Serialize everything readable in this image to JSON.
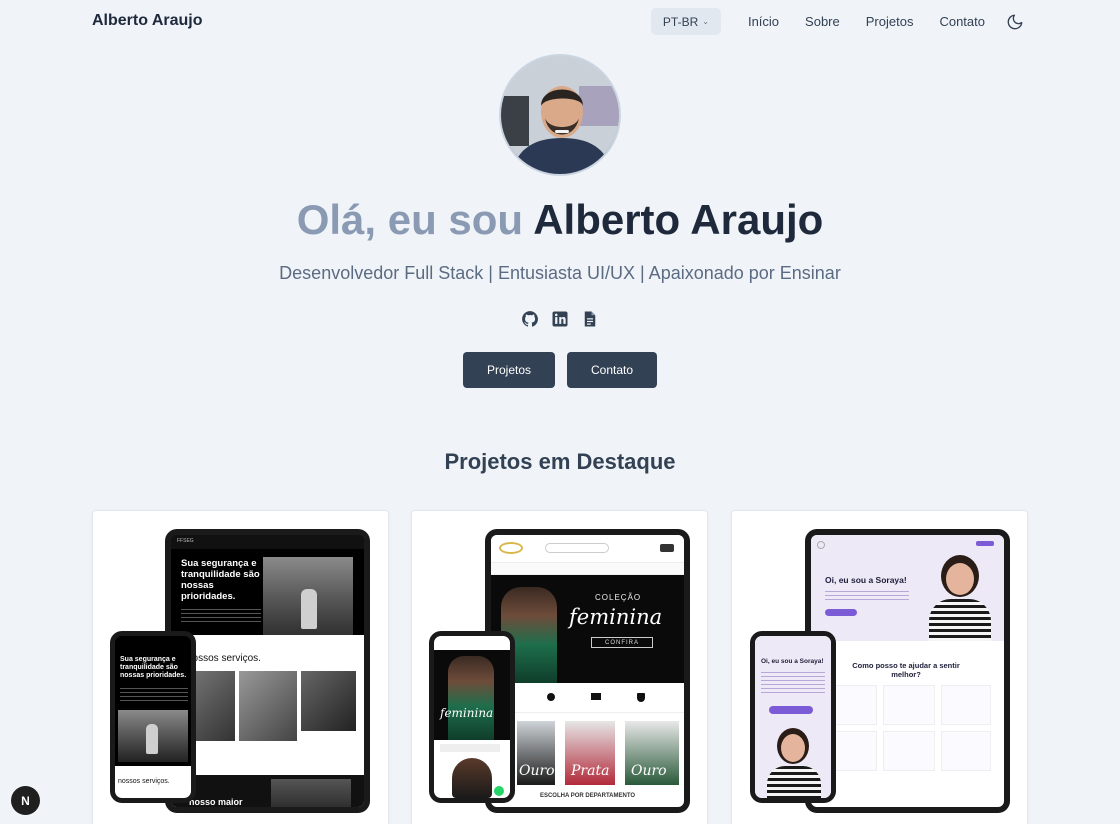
{
  "header": {
    "brand": "Alberto Araujo",
    "lang": "PT-BR",
    "nav": [
      "Início",
      "Sobre",
      "Projetos",
      "Contato"
    ]
  },
  "hero": {
    "greeting": "Olá, eu sou ",
    "name": "Alberto Araujo",
    "subtitle": "Desenvolvedor Full Stack | Entusiasta UI/UX | Apaixonado por Ensinar",
    "socials": [
      "github-icon",
      "linkedin-icon",
      "document-icon"
    ],
    "buttons": {
      "projects": "Projetos",
      "contact": "Contato"
    }
  },
  "featured": {
    "title": "Projetos em Destaque",
    "cards": [
      {
        "tablet_headline": "Sua segurança e tranquilidade são nossas prioridades.",
        "services": "nossos serviços.",
        "phone_headline": "Sua segurança e tranquilidade são nossas prioridades.",
        "phone_services": "nossos serviços.",
        "brand": "FFSEG",
        "bottom_text": "nosso maior"
      },
      {
        "collection": "COLEÇÃO",
        "feminina": "feminina",
        "confira": "CONFIRA",
        "departamento": "ESCOLHA POR DEPARTAMENTO",
        "labels": [
          "Ouro",
          "Prata",
          "Ouro"
        ]
      },
      {
        "greeting": "Oi, eu sou a Soraya!",
        "question": "Como posso te ajudar a sentir melhor?",
        "phone_greeting": "Oi, eu sou a Soraya!"
      }
    ]
  },
  "badge": {
    "label": "N"
  },
  "colors": {
    "background": "#f0f4f8",
    "button": "#334155",
    "accent_purple": "#7c5cd6",
    "heading": "#1e293b"
  }
}
